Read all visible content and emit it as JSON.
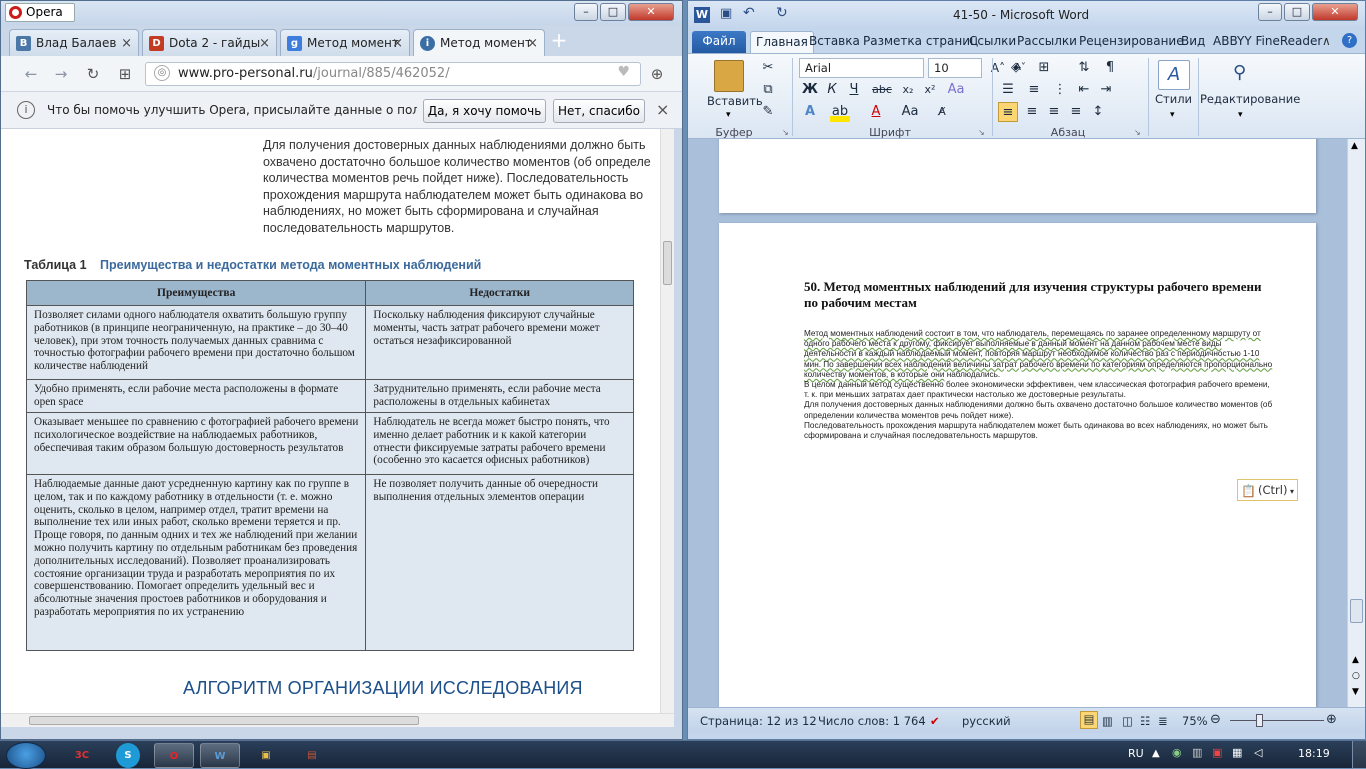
{
  "opera": {
    "app_name": "Opera",
    "tabs": [
      {
        "label": "Влад Балаев",
        "icon": "vk-icon",
        "color": "#4a76a8"
      },
      {
        "label": "Dota 2 - гайды",
        "icon": "dota-icon",
        "color": "#c23b22"
      },
      {
        "label": "Метод момент",
        "icon": "google-icon",
        "color": "#3c7dde"
      },
      {
        "label": "Метод момент",
        "icon": "site-icon",
        "color": "#3a6ea5"
      }
    ],
    "url_domain": "www.pro-personal.ru",
    "url_path": "/journal/885/462052/",
    "infobar_text": "Что бы помочь улучшить Opera, присылайте данные о пользова...",
    "infobar_yes": "Да, я хочу помочь",
    "infobar_no": "Нет, спасибо",
    "page": {
      "para_lines": [
        "Для получения достоверных данных наблюдениями должно быть",
        "охвачено достаточно большое количество моментов (об определе",
        "количества моментов речь пойдет ниже). Последовательность",
        "прохождения маршрута наблюдателем может быть одинакова во",
        "наблюдениях, но может быть сформирована и случайная",
        "последовательность маршрутов."
      ],
      "table_num": "Таблица 1",
      "table_title": "Преимущества и недостатки метода моментных наблюдений",
      "col_adv": "Преимущества",
      "col_dis": "Недостатки",
      "rows": [
        {
          "adv": "Позволяет силами одного наблюдателя охватить большую группу работников (в принципе неограниченную, на практике – до 30–40 человек), при этом точность получаемых данных сравнима с точностью фотографии рабочего времени при достаточно большом количестве наблюдений",
          "dis": "Поскольку наблюдения фиксируют случайные моменты, часть затрат рабочего времени может остаться незафиксированной"
        },
        {
          "adv": "Удобно применять, если рабочие места расположены в формате open space",
          "dis": "Затруднительно применять, если рабочие места расположены в отдельных кабинетах"
        },
        {
          "adv": "Оказывает меньшее по сравнению с фотографией рабочего времени психологическое воздействие на наблюдаемых работников, обеспечивая таким образом большую достоверность результатов",
          "dis": "Наблюдатель не всегда может быстро понять, что именно делает работник и к какой категории отнести фиксируемые затраты рабочего времени (особенно это касается офисных работников)"
        },
        {
          "adv": "Наблюдаемые данные дают усредненную картину как по группе в целом, так и по каждому работнику в отдельности (т. е. можно оценить, сколько в целом, например отдел, тратит времени на выполнение тех или иных работ, сколько времени теряется и пр. Проще говоря, по данным одних и тех же наблюдений при желании можно получить картину по отдельным работникам без проведения дополнительных исследований). Позволяет проанализировать состояние организации труда и разработать мероприятия по их совершенствованию. Помогает определить удельный вес и абсолютные значения простоев работников и оборудования и разработать мероприятия по их устранению",
          "dis": "Не позволяет получить данные об очередности выполнения отдельных элементов операции"
        }
      ],
      "section_heading": "АЛГОРИТМ ОРГАНИЗАЦИИ ИССЛЕДОВАНИЯ"
    }
  },
  "word": {
    "title": "41-50 - Microsoft Word",
    "tabs": [
      "Файл",
      "Главная",
      "Вставка",
      "Разметка страниц",
      "Ссылки",
      "Рассылки",
      "Рецензирование",
      "Вид",
      "ABBYY FineReader"
    ],
    "font_name": "Arial",
    "font_size": "10",
    "groups": {
      "clipboard": "Буфер обмена",
      "font": "Шрифт",
      "paragraph": "Абзац",
      "styles": "Стили",
      "editing": "Редактирование",
      "paste": "Вставить"
    },
    "doc": {
      "heading": "50. Метод моментных наблюдений для изучения структуры рабочего времени по рабочим местам",
      "p1": "Метод моментных наблюдений состоит в том, что наблюдатель, перемещаясь по заранее определенному маршруту от одного рабочего места к другому, фиксирует выполняемые в данный момент на данном рабочем месте виды деятельности в каждый наблюдаемый момент, повторяя маршрут необходимое количество раз с периодичностью 1-10 мин. По завершении всех наблюдений величины затрат рабочего времени по категориям определяются пропорционально количеству моментов, в которые они",
      "p1_end": "наблюдались.",
      "p2": "В целом данный метод существенно более экономически эффективен, чем классическая фотография рабочего времени, т. к. при меньших затратах дает практически настолько же достоверные результаты.",
      "p3": "Для получения достоверных данных наблюдениями должно быть охвачено достаточно большое количество моментов (об определении количества моментов речь пойдет ниже).",
      "p4": "Последовательность прохождения маршрута наблюдателем может быть одинакова во всех наблюдениях, но может быть сформирована и случайная последовательность маршрутов.",
      "paste_hint": "(Ctrl)"
    },
    "status": {
      "page": "Страница: 12 из 12",
      "words": "Число слов: 1 764",
      "lang": "русский",
      "zoom": "75%"
    }
  },
  "taskbar": {
    "lang": "RU",
    "time": "18:19"
  }
}
